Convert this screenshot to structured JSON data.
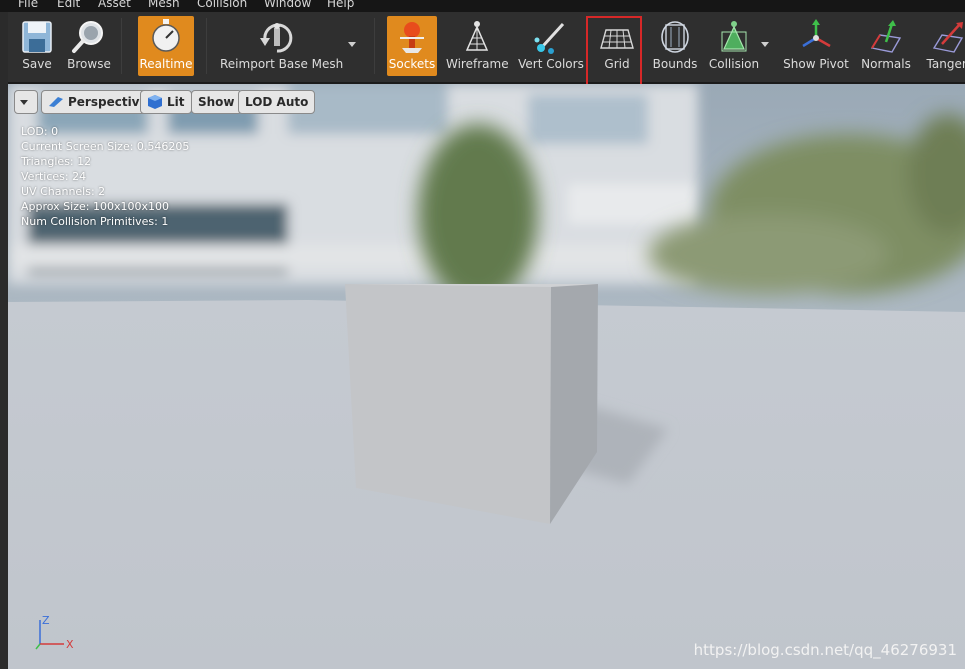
{
  "menu": [
    "File",
    "Edit",
    "Asset",
    "Mesh",
    "Collision",
    "Window",
    "Help"
  ],
  "toolbar": {
    "save": "Save",
    "browse": "Browse",
    "realtime": "Realtime",
    "reimport": "Reimport Base Mesh",
    "sockets": "Sockets",
    "wireframe": "Wireframe",
    "vert_colors": "Vert Colors",
    "grid": "Grid",
    "bounds": "Bounds",
    "collision": "Collision",
    "show_pivot": "Show Pivot",
    "normals": "Normals",
    "tangents": "Tangen"
  },
  "viewport_controls": {
    "perspective": "Perspective",
    "lit": "Lit",
    "show": "Show",
    "lod": "LOD Auto"
  },
  "stats": {
    "lod": "LOD:  0",
    "screen_size": "Current Screen Size:  0.546205",
    "triangles": "Triangles:  12",
    "vertices": "Vertices:  24",
    "uv_channels": "UV Channels:  2",
    "approx_size": "Approx Size: 100x100x100",
    "collision_prims": "Num Collision Primitives:  1"
  },
  "axes": {
    "z": "Z",
    "x": "X"
  },
  "colors": {
    "accent": "#e08a1e",
    "highlight": "#d62828"
  },
  "watermark": "https://blog.csdn.net/qq_46276931"
}
